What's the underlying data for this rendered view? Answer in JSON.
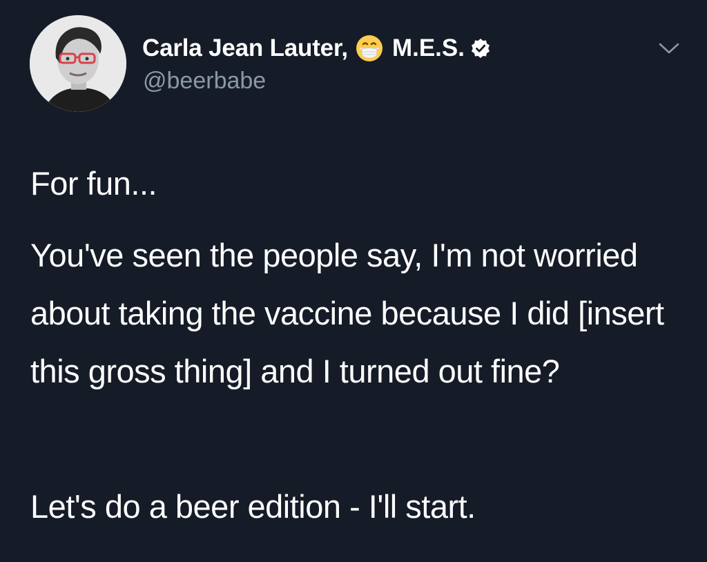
{
  "author": {
    "display_name": "Carla Jean Lauter,",
    "name_emoji": "face-with-medical-mask-emoji",
    "name_suffix": "M.E.S.",
    "verified": true,
    "handle": "@beerbabe"
  },
  "tweet": {
    "paragraphs": [
      "For fun...",
      "You've seen the people say, I'm not worried about taking the vaccine because I did [insert this gross thing] and I turned out fine?",
      "Let's do a beer edition - I'll start."
    ]
  },
  "colors": {
    "background": "#161c27",
    "text_primary": "#ffffff",
    "text_secondary": "#8b98a5"
  },
  "icons": {
    "verified": "verified-badge-icon",
    "more": "chevron-down-icon"
  }
}
